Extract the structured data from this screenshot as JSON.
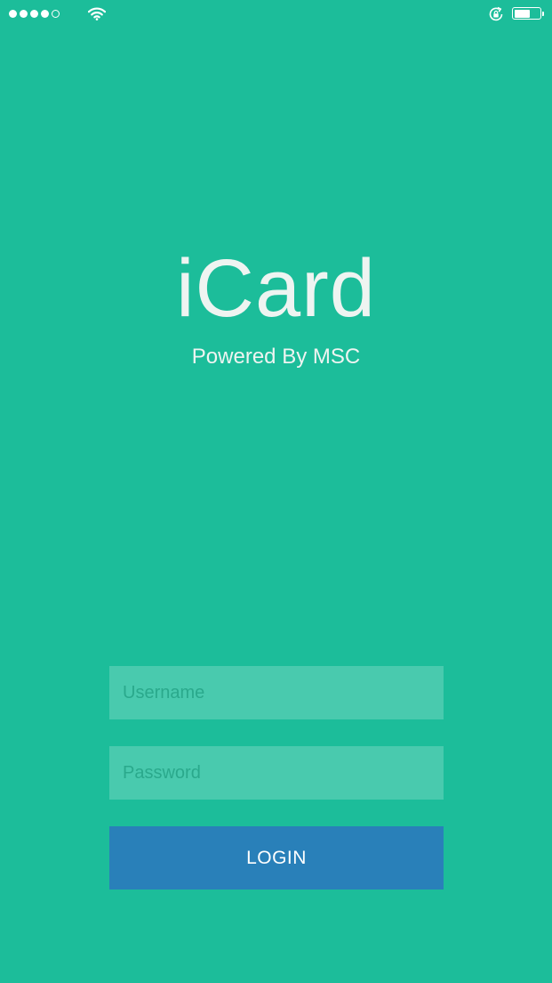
{
  "status_bar": {
    "signal_bars_filled": 4,
    "signal_bars_total": 5,
    "time": "",
    "icons": [
      "signal-dots",
      "wifi-icon",
      "rotation-lock-icon",
      "battery-icon"
    ],
    "battery_level": 0.65
  },
  "brand": {
    "title": "iCard",
    "subtitle": "Powered By MSC"
  },
  "form": {
    "username_placeholder": "Username",
    "username_value": "",
    "password_placeholder": "Password",
    "password_value": "",
    "login_label": "LOGIN"
  },
  "colors": {
    "background": "#1cbd9a",
    "field_background": "rgba(255,255,255,0.2)",
    "placeholder": "#2aa98c",
    "button": "#2980b9",
    "text": "#eef4f1"
  }
}
